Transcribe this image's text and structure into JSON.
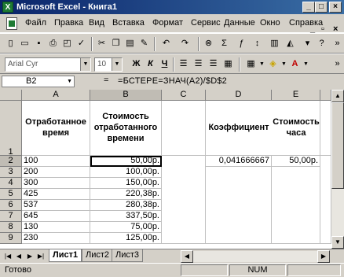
{
  "window": {
    "title": "Microsoft Excel - Книга1",
    "app_icon": "excel-icon"
  },
  "menu": {
    "items": [
      "Файл",
      "Правка",
      "Вид",
      "Вставка",
      "Формат",
      "Сервис",
      "Данные",
      "Окно",
      "Справка"
    ]
  },
  "toolbar_standard": {
    "icons": [
      "new-icon",
      "open-icon",
      "save-icon",
      "print-icon",
      "print-preview-icon",
      "spelling-icon",
      "cut-icon",
      "copy-icon",
      "paste-icon",
      "format-painter-icon",
      "undo-icon",
      "redo-icon",
      "hyperlink-icon",
      "autosum-icon",
      "function-icon",
      "sort-icon",
      "chart-wizard-icon",
      "help-icon"
    ]
  },
  "toolbar_formatting": {
    "font_name": "Arial Cyr",
    "font_size": "10",
    "bold_label": "Ж",
    "italic_label": "К",
    "underline_label": "Ч"
  },
  "formula_bar": {
    "name_box": "B2",
    "fx": "=",
    "formula": "=БСТЕРЕ=ЗНАЧ(A2)/$D$2"
  },
  "columns": [
    "A",
    "B",
    "C",
    "D",
    "E"
  ],
  "rows": [
    "1",
    "2",
    "3",
    "4",
    "5",
    "6",
    "7",
    "8",
    "9"
  ],
  "headers": {
    "a1": "Отработанное время",
    "b1": "Стоимость отработанного времени",
    "d1": "Коэффициент",
    "e1": "Стоимость часа"
  },
  "data": {
    "col_a": [
      "100",
      "200",
      "300",
      "425",
      "537",
      "645",
      "130",
      "230"
    ],
    "col_b": [
      "50,00р.",
      "100,00р.",
      "150,00р.",
      "220,38р.",
      "280,38р.",
      "337,50р.",
      "75,00р.",
      "125,00р."
    ],
    "d2": "0,041666667",
    "e2": "50,00р."
  },
  "sheets": [
    "Лист1",
    "Лист2",
    "Лист3"
  ],
  "active_sheet": "Лист1",
  "status": {
    "ready": "Готово",
    "num": "NUM"
  },
  "colors": {
    "title_start": "#0a246a",
    "title_end": "#3a6ea5",
    "chrome": "#d4d0c8"
  }
}
